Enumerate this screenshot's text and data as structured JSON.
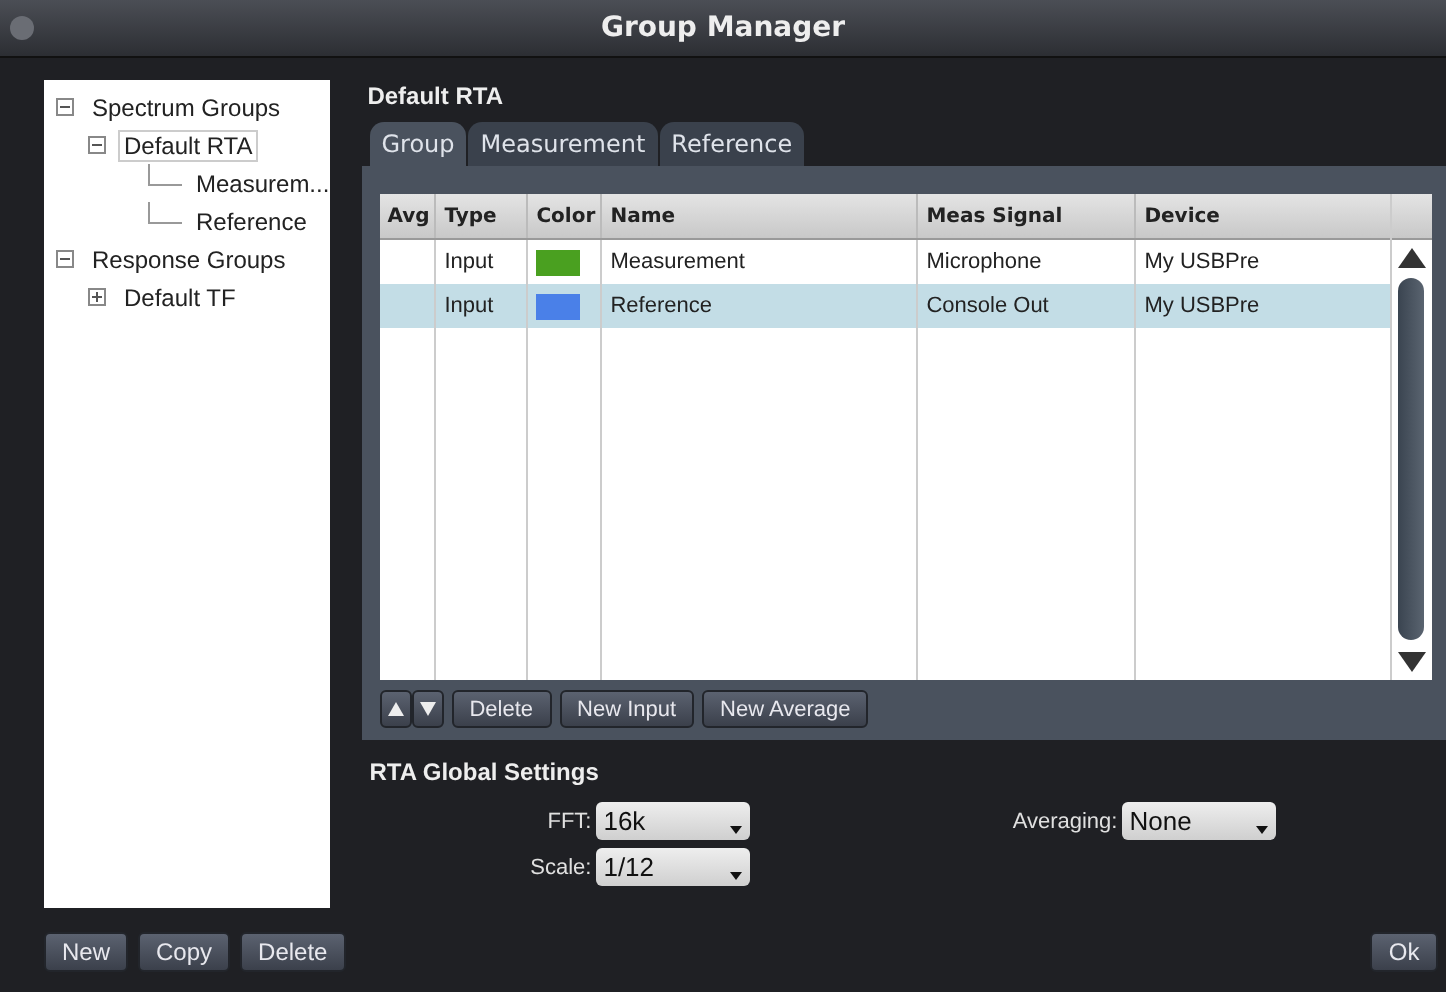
{
  "window": {
    "title": "Group Manager"
  },
  "tree": [
    {
      "label": "Spectrum Groups",
      "expanded": true,
      "selected": false,
      "children": [
        {
          "label": "Default RTA",
          "expanded": true,
          "selected": true,
          "children": [
            {
              "label": "Measurem...",
              "selected": false
            },
            {
              "label": "Reference",
              "selected": false
            }
          ]
        }
      ]
    },
    {
      "label": "Response Groups",
      "expanded": true,
      "selected": false,
      "children": [
        {
          "label": "Default TF",
          "expanded": false,
          "selected": false
        }
      ]
    }
  ],
  "left_buttons": [
    "New",
    "Copy",
    "Delete"
  ],
  "group_title": "Default RTA",
  "tabs": [
    {
      "label": "Group",
      "selected": true
    },
    {
      "label": "Measurement",
      "selected": false
    },
    {
      "label": "Reference",
      "selected": false
    }
  ],
  "table": {
    "columns": [
      "Avg",
      "Type",
      "Color",
      "Name",
      "Meas Signal",
      "Device"
    ],
    "rows": [
      {
        "type": "Input",
        "color": "#4aa020",
        "name": "Measurement",
        "meas_signal": "Microphone",
        "device": "My USBPre",
        "selected": false
      },
      {
        "type": "Input",
        "color": "#4a80e8",
        "name": "Reference",
        "meas_signal": "Console Out",
        "device": "My USBPre",
        "selected": true
      }
    ]
  },
  "table_buttons": [
    "Delete",
    "New Input",
    "New Average"
  ],
  "settings": {
    "title": "RTA Global Settings",
    "fft": {
      "label": "FFT:",
      "value": "16k"
    },
    "scale": {
      "label": "Scale:",
      "value": "1/12"
    },
    "averaging": {
      "label": "Averaging:",
      "value": "None"
    }
  },
  "ok_button": "Ok"
}
